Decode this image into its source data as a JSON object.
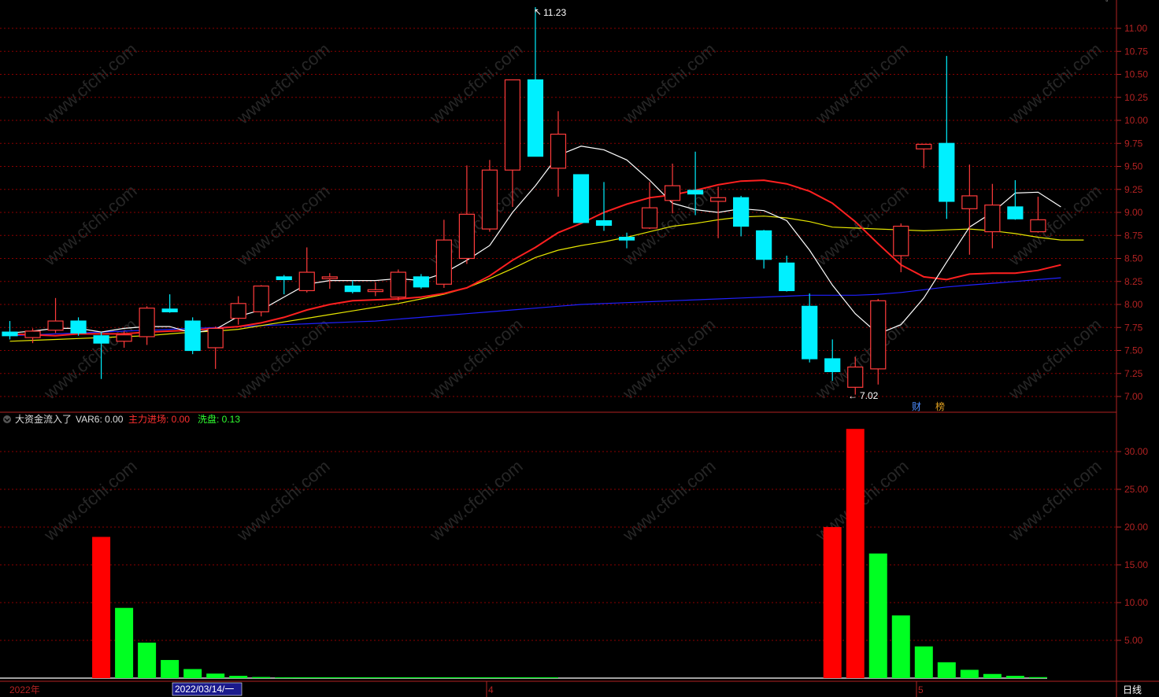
{
  "colors": {
    "background": "#000000",
    "grid": "#8b0000",
    "axis": "#b22222",
    "up": "#ff3b3b",
    "down": "#00f0ff",
    "ma5": "#ffffff",
    "ma10": "#ff2020",
    "ma20": "#e6e600",
    "ma60": "#2020ff",
    "bar_red": "#ff0000",
    "bar_green": "#00ff22",
    "watermark": "#2a2a2a"
  },
  "watermark": "www.cfchi.com",
  "price_panel": {
    "y_ticks": [
      "11.00",
      "10.75",
      "10.50",
      "10.25",
      "10.00",
      "9.75",
      "9.50",
      "9.25",
      "9.00",
      "8.75",
      "8.50",
      "8.25",
      "8.00",
      "7.75",
      "7.50",
      "7.25",
      "7.00"
    ],
    "high_label": "11.23",
    "low_label": "7.02",
    "badge_cai": "财",
    "badge_bang": "榜"
  },
  "indicator_panel": {
    "name": "大资金流入了",
    "var6_label": "VAR6: 0.00",
    "zhuli_label": "主力进场: 0.00",
    "xipan_label": "洗盘: 0.13",
    "y_ticks": [
      "30.00",
      "25.00",
      "20.00",
      "15.00",
      "10.00",
      "5.00"
    ]
  },
  "x_axis": {
    "start_label": "2022年",
    "cursor_date": "2022/03/14/一",
    "month_4": "4",
    "month_5": "5",
    "period": "日线"
  },
  "chart_data": [
    {
      "type": "candlestick",
      "ylim": [
        6.94,
        11.28
      ],
      "candles": [
        {
          "o": 7.7,
          "c": 7.66,
          "h": 7.82,
          "l": 7.62
        },
        {
          "o": 7.64,
          "c": 7.71,
          "h": 7.74,
          "l": 7.58
        },
        {
          "o": 7.72,
          "c": 7.82,
          "h": 8.07,
          "l": 7.69
        },
        {
          "o": 7.82,
          "c": 7.69,
          "h": 7.86,
          "l": 7.66
        },
        {
          "o": 7.66,
          "c": 7.58,
          "h": 7.7,
          "l": 7.19
        },
        {
          "o": 7.6,
          "c": 7.67,
          "h": 7.71,
          "l": 7.53
        },
        {
          "o": 7.65,
          "c": 7.96,
          "h": 7.98,
          "l": 7.56
        },
        {
          "o": 7.95,
          "c": 7.92,
          "h": 8.11,
          "l": 7.91
        },
        {
          "o": 7.82,
          "c": 7.5,
          "h": 7.86,
          "l": 7.46
        },
        {
          "o": 7.53,
          "c": 7.74,
          "h": 7.76,
          "l": 7.3
        },
        {
          "o": 7.85,
          "c": 8.01,
          "h": 8.09,
          "l": 7.78
        },
        {
          "o": 7.92,
          "c": 8.2,
          "h": 8.21,
          "l": 7.87
        },
        {
          "o": 8.3,
          "c": 8.27,
          "h": 8.32,
          "l": 8.11
        },
        {
          "o": 8.15,
          "c": 8.35,
          "h": 8.62,
          "l": 8.13
        },
        {
          "o": 8.28,
          "c": 8.3,
          "h": 8.34,
          "l": 8.17
        },
        {
          "o": 8.2,
          "c": 8.14,
          "h": 8.26,
          "l": 8.12
        },
        {
          "o": 8.14,
          "c": 8.16,
          "h": 8.24,
          "l": 8.09
        },
        {
          "o": 8.08,
          "c": 8.35,
          "h": 8.38,
          "l": 8.04
        },
        {
          "o": 8.3,
          "c": 8.19,
          "h": 8.33,
          "l": 8.17
        },
        {
          "o": 8.22,
          "c": 8.7,
          "h": 8.92,
          "l": 8.18
        },
        {
          "o": 8.5,
          "c": 8.98,
          "h": 9.51,
          "l": 8.44
        },
        {
          "o": 8.82,
          "c": 9.46,
          "h": 9.57,
          "l": 8.79
        },
        {
          "o": 9.46,
          "c": 10.44,
          "h": 10.44,
          "l": 9.06
        },
        {
          "o": 10.44,
          "c": 9.61,
          "h": 11.23,
          "l": 9.61
        },
        {
          "o": 9.48,
          "c": 9.85,
          "h": 10.1,
          "l": 9.17
        },
        {
          "o": 9.41,
          "c": 8.89,
          "h": 9.41,
          "l": 8.89
        },
        {
          "o": 8.91,
          "c": 8.86,
          "h": 9.33,
          "l": 8.8
        },
        {
          "o": 8.73,
          "c": 8.7,
          "h": 8.78,
          "l": 8.61
        },
        {
          "o": 8.83,
          "c": 9.05,
          "h": 9.33,
          "l": 8.82
        },
        {
          "o": 9.13,
          "c": 9.29,
          "h": 9.53,
          "l": 8.99
        },
        {
          "o": 9.24,
          "c": 9.2,
          "h": 9.66,
          "l": 8.97
        },
        {
          "o": 9.12,
          "c": 9.16,
          "h": 9.28,
          "l": 8.72
        },
        {
          "o": 9.16,
          "c": 8.85,
          "h": 9.18,
          "l": 8.74
        },
        {
          "o": 8.8,
          "c": 8.49,
          "h": 8.81,
          "l": 8.39
        },
        {
          "o": 8.45,
          "c": 8.15,
          "h": 8.53,
          "l": 8.14
        },
        {
          "o": 7.98,
          "c": 7.41,
          "h": 8.12,
          "l": 7.37
        },
        {
          "o": 7.41,
          "c": 7.27,
          "h": 7.62,
          "l": 7.17
        },
        {
          "o": 7.1,
          "c": 7.32,
          "h": 7.43,
          "l": 7.02
        },
        {
          "o": 7.3,
          "c": 8.04,
          "h": 8.06,
          "l": 7.13
        },
        {
          "o": 8.53,
          "c": 8.85,
          "h": 8.88,
          "l": 8.35
        },
        {
          "o": 9.69,
          "c": 9.74,
          "h": 9.74,
          "l": 9.48
        },
        {
          "o": 9.75,
          "c": 9.12,
          "h": 10.7,
          "l": 8.93
        },
        {
          "o": 9.04,
          "c": 9.18,
          "h": 9.52,
          "l": 8.54
        },
        {
          "o": 8.79,
          "c": 9.08,
          "h": 9.31,
          "l": 8.61
        },
        {
          "o": 9.06,
          "c": 8.93,
          "h": 9.35,
          "l": 8.92
        },
        {
          "o": 8.79,
          "c": 8.92,
          "h": 9.17,
          "l": 8.78
        }
      ],
      "ma5": [
        7.69,
        7.71,
        7.74,
        7.74,
        7.7,
        7.74,
        7.76,
        7.76,
        7.69,
        7.73,
        7.87,
        7.94,
        8.08,
        8.22,
        8.26,
        8.26,
        8.26,
        8.28,
        8.26,
        8.34,
        8.48,
        8.64,
        9.0,
        9.29,
        9.62,
        9.72,
        9.68,
        9.57,
        9.35,
        9.1,
        9.03,
        9.0,
        9.04,
        9.02,
        8.91,
        8.59,
        8.21,
        7.9,
        7.68,
        7.78,
        8.07,
        8.46,
        8.84,
        9.0,
        9.21,
        9.22,
        9.06
      ],
      "ma10": [
        7.68,
        7.67,
        7.66,
        7.68,
        7.68,
        7.68,
        7.7,
        7.71,
        7.72,
        7.74,
        7.76,
        7.8,
        7.86,
        7.94,
        8.0,
        8.04,
        8.05,
        8.06,
        8.08,
        8.12,
        8.18,
        8.31,
        8.48,
        8.62,
        8.78,
        8.88,
        9.0,
        9.09,
        9.16,
        9.19,
        9.24,
        9.3,
        9.34,
        9.35,
        9.31,
        9.23,
        9.1,
        8.9,
        8.66,
        8.43,
        8.3,
        8.27,
        8.33,
        8.34,
        8.34,
        8.37,
        8.43
      ],
      "ma20": [
        7.6,
        7.61,
        7.62,
        7.63,
        7.64,
        7.65,
        7.66,
        7.68,
        7.7,
        7.71,
        7.73,
        7.77,
        7.81,
        7.85,
        7.89,
        7.93,
        7.97,
        8.01,
        8.06,
        8.11,
        8.18,
        8.28,
        8.39,
        8.51,
        8.59,
        8.64,
        8.68,
        8.73,
        8.79,
        8.85,
        8.88,
        8.92,
        8.95,
        8.96,
        8.94,
        8.9,
        8.84,
        8.83,
        8.82,
        8.81,
        8.8,
        8.81,
        8.82,
        8.8,
        8.77,
        8.73,
        8.7,
        8.7
      ],
      "ma60": [
        7.66,
        7.67,
        7.68,
        7.69,
        7.7,
        7.71,
        7.72,
        7.73,
        7.74,
        7.75,
        7.76,
        7.77,
        7.78,
        7.79,
        7.8,
        7.81,
        7.82,
        7.84,
        7.86,
        7.88,
        7.9,
        7.92,
        7.94,
        7.96,
        7.98,
        8.0,
        8.01,
        8.02,
        8.03,
        8.04,
        8.05,
        8.06,
        8.07,
        8.08,
        8.09,
        8.1,
        8.1,
        8.1,
        8.11,
        8.13,
        8.16,
        8.19,
        8.21,
        8.23,
        8.25,
        8.27,
        8.29
      ]
    },
    {
      "type": "bar",
      "name": "大资金流入了",
      "ylim": [
        0,
        34
      ],
      "bars": [
        {
          "i": 4,
          "v": 18.7,
          "color": "red"
        },
        {
          "i": 5,
          "v": 9.3,
          "color": "green"
        },
        {
          "i": 6,
          "v": 4.7,
          "color": "green"
        },
        {
          "i": 7,
          "v": 2.4,
          "color": "green"
        },
        {
          "i": 8,
          "v": 1.2,
          "color": "green"
        },
        {
          "i": 9,
          "v": 0.6,
          "color": "green"
        },
        {
          "i": 10,
          "v": 0.3,
          "color": "green"
        },
        {
          "i": 11,
          "v": 0.15,
          "color": "green"
        },
        {
          "i": 12,
          "v": 0.1,
          "color": "green"
        },
        {
          "i": 36,
          "v": 20.0,
          "color": "red"
        },
        {
          "i": 37,
          "v": 33.0,
          "color": "red"
        },
        {
          "i": 38,
          "v": 16.5,
          "color": "green"
        },
        {
          "i": 39,
          "v": 8.3,
          "color": "green"
        },
        {
          "i": 40,
          "v": 4.2,
          "color": "green"
        },
        {
          "i": 41,
          "v": 2.1,
          "color": "green"
        },
        {
          "i": 42,
          "v": 1.1,
          "color": "green"
        },
        {
          "i": 43,
          "v": 0.55,
          "color": "green"
        },
        {
          "i": 44,
          "v": 0.3,
          "color": "green"
        },
        {
          "i": 45,
          "v": 0.13,
          "color": "green"
        }
      ]
    }
  ]
}
